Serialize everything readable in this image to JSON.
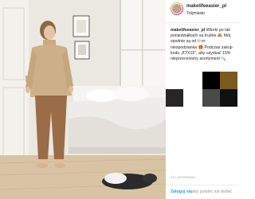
{
  "post": {
    "username": "makelifeeasier_pl",
    "location": "Trójmiasto",
    "caption_lines": [
      "Wtorki po tak",
      "poniedziałkach są trudne 🙈 Mój",
      "spodnie są od i          i m",
      "niespodzianka 🎁 Podczas zakup",
      "kodu „KTX15\", aby uzyskać 15%",
      "nieprzeceniony asortyment 🔍"
    ],
    "date": "11 LISTOPADA",
    "login_link": "Zaloguj się",
    "login_rest": ", aby polubić lub dodać"
  },
  "photo": {
    "alt": "Woman in beige sweater and trousers standing in a bright bedroom"
  },
  "tiles": [
    {
      "color": "#000000"
    },
    {
      "color": "#7a5a1e"
    },
    {
      "color": "#f4f1ec"
    },
    {
      "color": "#262626"
    },
    {
      "color": "#1a1a1a"
    },
    {
      "color": "#4a4a4a"
    },
    {
      "color": "#101010"
    },
    {
      "color": "#eaeaea"
    }
  ],
  "colors": {
    "link": "#3897f0",
    "text": "#262626",
    "muted": "#999999"
  }
}
